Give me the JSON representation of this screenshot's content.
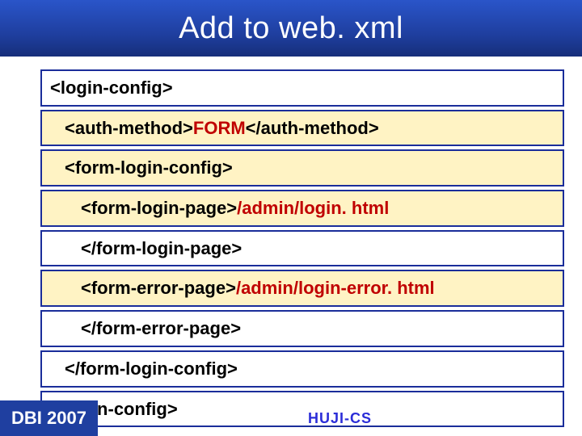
{
  "title": "Add to web. xml",
  "rows": [
    {
      "bg": "plain",
      "indent": 0,
      "pre": "<login-config>",
      "val": "",
      "post": ""
    },
    {
      "bg": "yellow",
      "indent": 1,
      "pre": "<auth-method>",
      "val": "FORM",
      "post": "</auth-method>"
    },
    {
      "bg": "yellow",
      "indent": 1,
      "pre": "<form-login-config>",
      "val": "",
      "post": ""
    },
    {
      "bg": "yellow",
      "indent": 2,
      "pre": "<form-login-page>",
      "val": "/admin/login. html",
      "post": ""
    },
    {
      "bg": "plain",
      "indent": 2,
      "pre": "</form-login-page>",
      "val": "",
      "post": ""
    },
    {
      "bg": "yellow",
      "indent": 2,
      "pre": "<form-error-page>",
      "val": "/admin/login-error. html",
      "post": ""
    },
    {
      "bg": "plain",
      "indent": 2,
      "pre": "</form-error-page>",
      "val": "",
      "post": ""
    },
    {
      "bg": "plain",
      "indent": 1,
      "pre": "</form-login-config>",
      "val": "",
      "post": ""
    },
    {
      "bg": "plain",
      "indent": 0,
      "pre": "</login-config>",
      "val": "",
      "post": ""
    }
  ],
  "footer": {
    "left": "DBI 2007",
    "center": "HUJI-CS"
  }
}
